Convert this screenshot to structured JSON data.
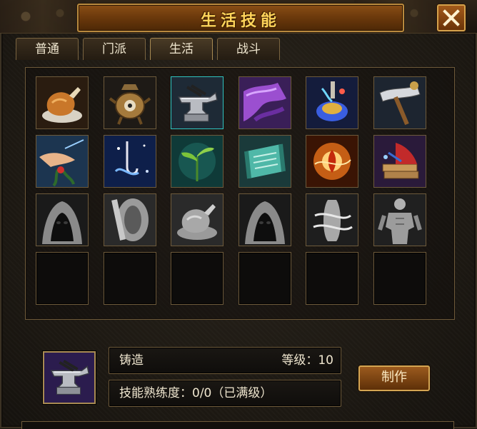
{
  "window": {
    "title": "生活技能"
  },
  "tabs": [
    {
      "label": "普通"
    },
    {
      "label": "门派"
    },
    {
      "label": "生活",
      "active": true
    },
    {
      "label": "战斗"
    }
  ],
  "grid": {
    "rows": 4,
    "cols": 6,
    "skills": [
      {
        "icon": "roast-chicken-icon",
        "active": true
      },
      {
        "icon": "alchemy-cauldron-icon",
        "active": true
      },
      {
        "icon": "anvil-icon",
        "active": true,
        "selected": true
      },
      {
        "icon": "tailoring-cloth-icon",
        "active": true
      },
      {
        "icon": "potion-flask-icon",
        "active": true
      },
      {
        "icon": "mining-hammer-icon",
        "active": true
      },
      {
        "icon": "herb-picking-hand-icon",
        "active": true
      },
      {
        "icon": "fishing-hook-icon",
        "active": true
      },
      {
        "icon": "seedling-icon",
        "active": true
      },
      {
        "icon": "scroll-icon",
        "active": true
      },
      {
        "icon": "fire-spirit-icon",
        "active": true
      },
      {
        "icon": "book-craft-icon",
        "active": true
      },
      {
        "icon": "hooded-figure-icon",
        "active": false
      },
      {
        "icon": "wheel-icon",
        "active": false
      },
      {
        "icon": "roast-chicken-icon",
        "active": false
      },
      {
        "icon": "hooded-figure-icon",
        "active": false
      },
      {
        "icon": "swirl-spirit-icon",
        "active": false
      },
      {
        "icon": "muscle-statue-icon",
        "active": false
      }
    ]
  },
  "selected_skill": {
    "icon": "anvil-icon",
    "name": "铸造",
    "level_label": "等级：10",
    "proficiency": "技能熟练度：0/0（已满级）"
  },
  "actions": {
    "make_label": "制作"
  },
  "colors": {
    "title_gold": "#ffd45a",
    "selected_border": "#2fc4c0",
    "frame_border": "#6e5a3a"
  }
}
